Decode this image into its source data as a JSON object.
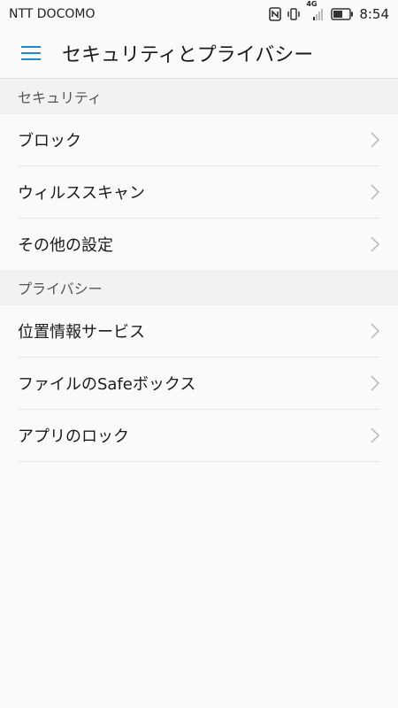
{
  "status_bar": {
    "carrier": "NTT DOCOMO",
    "network": "4G",
    "time": "8:54",
    "icons": [
      "nfc-icon",
      "vibrate-icon",
      "signal-icon",
      "battery-icon"
    ]
  },
  "app_bar": {
    "title": "セキュリティとプライバシー",
    "menu_icon": "hamburger-menu-icon",
    "accent_color": "#1e88e5"
  },
  "sections": [
    {
      "header": "セキュリティ",
      "items": [
        {
          "label": "ブロック"
        },
        {
          "label": "ウィルススキャン"
        },
        {
          "label": "その他の設定"
        }
      ]
    },
    {
      "header": "プライバシー",
      "items": [
        {
          "label": "位置情報サービス"
        },
        {
          "label": "ファイルのSafeボックス"
        },
        {
          "label": "アプリのロック"
        }
      ]
    }
  ]
}
